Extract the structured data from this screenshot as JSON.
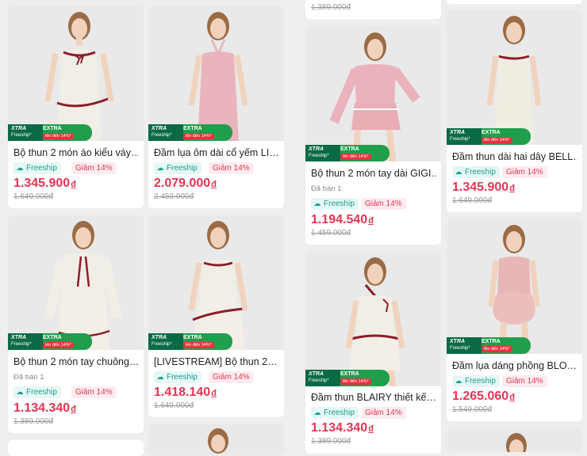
{
  "badge": {
    "xtra": "XTRA",
    "freeship_small": "Freeship*",
    "extra": "EXTRA",
    "up_to": "lên đến 14%*"
  },
  "colors": {
    "price": "#e13754",
    "freeship_bg": "#e6f7f5",
    "freeship_text": "#1a9e8f",
    "discount_bg": "#fdecef",
    "badge_dark_green": "#0a6a45",
    "badge_green": "#1f9e4c"
  },
  "top_fragments": {
    "col3_old_price": "1.389.000đ"
  },
  "products": [
    {
      "name": "Bộ thun 2 món áo kiểu váy…",
      "freeship": "Freeship",
      "discount": "Giảm 14%",
      "price": "1.345.900",
      "currency": "đ",
      "old_price": "1.649.000đ",
      "outfit": "cream dress with red ribbon trim"
    },
    {
      "name": "Đầm lụa ôm dài cổ yếm  LI…",
      "freeship": "Freeship",
      "discount": "Giảm 14%",
      "price": "2.079.000",
      "currency": "đ",
      "old_price": "2.459.000đ",
      "outfit": "pink halter maxi dress"
    },
    {
      "name": "Bộ thun 2 món tay dài GIGI…",
      "sold": "Đã bán 1",
      "freeship": "Freeship",
      "discount": "Giảm 14%",
      "price": "1.194.540",
      "currency": "đ",
      "old_price": "1.459.000đ",
      "outfit": "pink off-shoulder top and skirt"
    },
    {
      "name": "Đầm thun dài hai dây BELL…",
      "freeship": "Freeship",
      "discount": "Giảm 14%",
      "price": "1.345.900",
      "currency": "đ",
      "old_price": "1.649.000đ",
      "outfit": "cream strap dress"
    },
    {
      "name": "Bộ thun 2 món tay chuông…",
      "sold": "Đã bán 1",
      "freeship": "Freeship",
      "discount": "Giảm 14%",
      "price": "1.134.340",
      "currency": "đ",
      "old_price": "1.389.000đ",
      "outfit": "cream cardigan and skirt set"
    },
    {
      "name": "[LIVESTREAM] Bộ thun 2…",
      "freeship": "Freeship",
      "discount": "Giảm 14%",
      "price": "1.418.140",
      "currency": "đ",
      "old_price": "1.649.000đ",
      "outfit": "cream strap top and skirt"
    },
    {
      "name": "Đầm thun BLAIRY thiết kế…",
      "freeship": "Freeship",
      "discount": "Giảm 14%",
      "price": "1.134.340",
      "currency": "đ",
      "old_price": "1.389.000đ",
      "outfit": "cream halter mini dress"
    },
    {
      "name": "Đầm lụa dáng phồng BLO…",
      "freeship": "Freeship",
      "discount": "Giảm 14%",
      "price": "1.265.060",
      "currency": "đ",
      "old_price": "1.549.000đ",
      "outfit": "pink bubble dress"
    }
  ]
}
